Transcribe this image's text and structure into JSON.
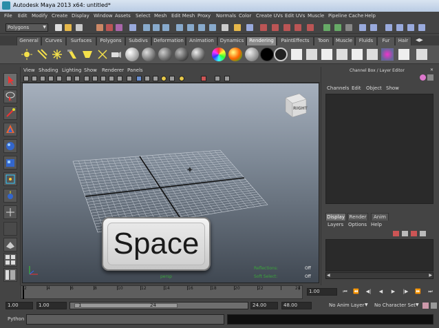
{
  "window": {
    "title": "Autodesk Maya 2013 x64: untitled*"
  },
  "menu": [
    "File",
    "Edit",
    "Modify",
    "Create",
    "Display",
    "Window",
    "Assets",
    "Select",
    "Mesh",
    "Edit Mesh",
    "Proxy",
    "Normals",
    "Color",
    "Create UVs",
    "Edit UVs",
    "Muscle",
    "Pipeline Cache",
    "Help"
  ],
  "status": {
    "mode": "Polygons"
  },
  "shelf": {
    "tabs": [
      "General",
      "Curves",
      "Surfaces",
      "Polygons",
      "Subdivs",
      "Deformation",
      "Animation",
      "Dynamics",
      "Rendering",
      "PaintEffects",
      "Toon",
      "Muscle",
      "Fluids",
      "Fur",
      "Hair"
    ],
    "active_tab": "Rendering"
  },
  "panel": {
    "menu": [
      "View",
      "Shading",
      "Lighting",
      "Show",
      "Renderer",
      "Panels"
    ],
    "viewcube_label": "RIGHT",
    "camera": "persp",
    "hud": [
      {
        "label": "Reflections:",
        "value": "Off"
      },
      {
        "label": "Soft Select:",
        "value": "Off"
      }
    ]
  },
  "overlay": {
    "key_label": "Space"
  },
  "channel_box": {
    "title": "Channel Box / Layer Editor",
    "menu": [
      "Channels",
      "Edit",
      "Object",
      "Show"
    ],
    "layer_tabs": [
      "Display",
      "Render",
      "Anim"
    ],
    "active_layer_tab": "Display",
    "layer_menu": [
      "Layers",
      "Options",
      "Help"
    ]
  },
  "time_slider": {
    "ticks": [
      "2",
      "4",
      "6",
      "8",
      "10",
      "12",
      "14",
      "16",
      "18",
      "20",
      "22",
      "24"
    ],
    "current_time": "1.00"
  },
  "range": {
    "start": "1.00",
    "anim_start": "1.00",
    "slider_start": "1",
    "slider_end": "24",
    "end": "24.00",
    "anim_end": "48.00",
    "anim_layer": "No Anim Layer",
    "character_set": "No Character Set"
  },
  "command_line": {
    "language": "Python"
  }
}
